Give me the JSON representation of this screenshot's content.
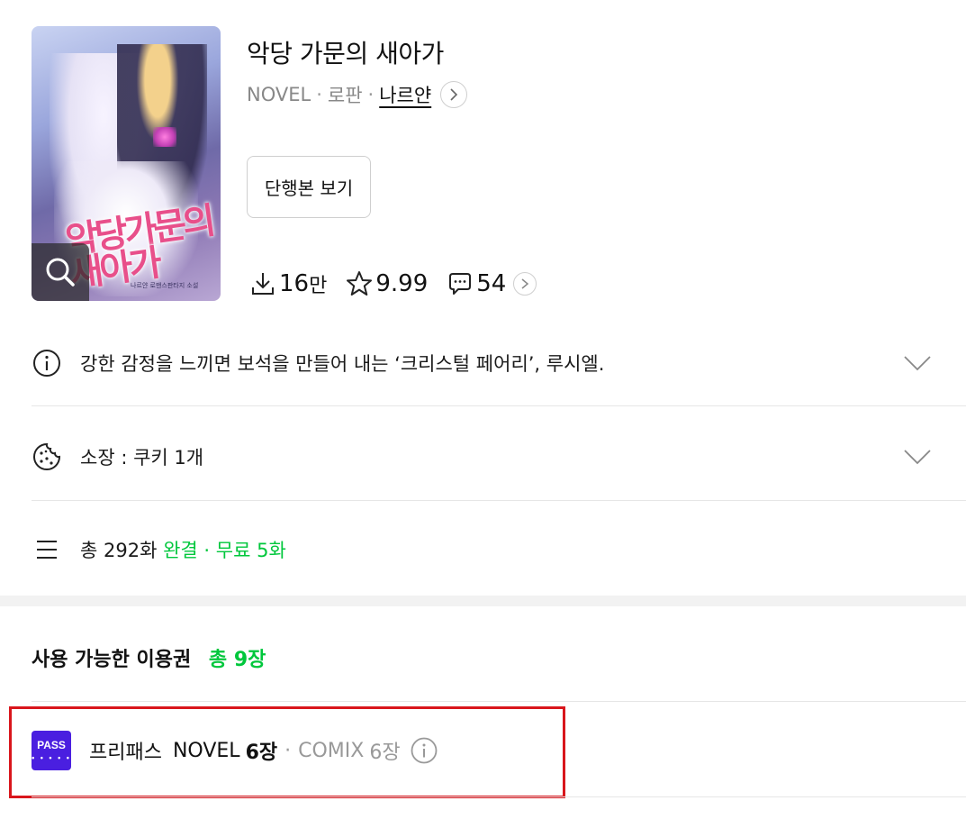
{
  "book": {
    "title": "악당 가문의 새아가",
    "category": "NOVEL",
    "genre": "로판",
    "author": "나르얀",
    "cover_title": "악당가문의 새아가",
    "cover_author": "나르얀 로맨스판타지 소설",
    "volume_button": "단행본 보기"
  },
  "stats": {
    "downloads": "16",
    "downloads_unit": "만",
    "rating": "9.99",
    "comments": "54"
  },
  "synopsis": {
    "text": "강한 감정을 느끼면 보석을 만들어 내는 ‘크리스털 페어리’, 루시엘."
  },
  "ownership": {
    "text": "소장 : 쿠키 1개"
  },
  "episodes": {
    "total": "총 292화",
    "status": "완결",
    "sep": "·",
    "free": "무료 5화"
  },
  "tickets": {
    "section_title": "사용 가능한 이용권",
    "total": "총 9장",
    "pass_badge": "PASS",
    "pass_badge_dots": "• • • • •",
    "pass_name": "프리패스",
    "novel_label": "NOVEL",
    "novel_count": "6장",
    "sep": "·",
    "comix_label": "COMIX",
    "comix_count": "6장"
  },
  "icons": {
    "zoom": "search-icon",
    "download": "download-icon",
    "star": "star-icon",
    "comment": "comment-icon",
    "info": "info-icon",
    "cookie": "cookie-icon",
    "list": "list-icon",
    "chevron": "chevron-down-icon"
  },
  "colors": {
    "accent_green": "#00c73c",
    "pass_purple": "#4a1fe0",
    "highlight_red": "#d9161c"
  }
}
